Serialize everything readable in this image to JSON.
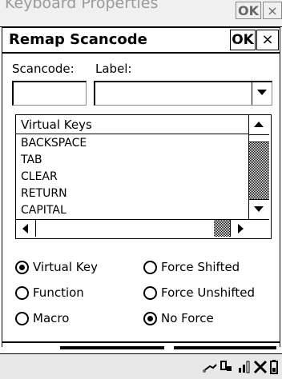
{
  "background_window": {
    "title": "Keyboard Properties",
    "ok_label": "OK",
    "close_label": "×"
  },
  "dialog": {
    "title": "Remap Scancode",
    "ok_label": "OK",
    "close_label": "×",
    "scancode_label": "Scancode:",
    "label_label": "Label:",
    "scancode_value": "",
    "label_value": ""
  },
  "list": {
    "header": "Virtual Keys",
    "items": [
      "BACKSPACE",
      "TAB",
      "CLEAR",
      "RETURN",
      "CAPITAL"
    ]
  },
  "radios": {
    "virtual_key": {
      "label": "Virtual Key",
      "checked": true
    },
    "function": {
      "label": "Function",
      "checked": false
    },
    "macro": {
      "label": "Macro",
      "checked": false
    },
    "force_shifted": {
      "label": "Force Shifted",
      "checked": false
    },
    "force_unshifted": {
      "label": "Force Unshifted",
      "checked": false
    },
    "no_force": {
      "label": "No Force",
      "checked": true
    }
  },
  "taskbar": {
    "icons": [
      "network-icon",
      "connection-icon",
      "signal-icon",
      "no-signal-icon",
      "battery-icon"
    ]
  }
}
